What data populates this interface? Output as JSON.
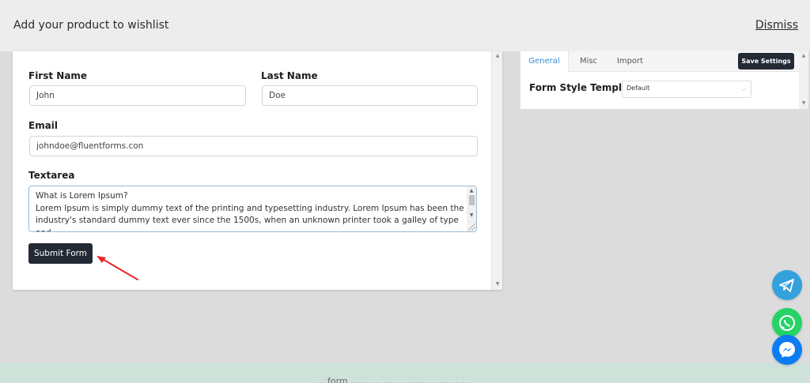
{
  "header": {
    "title": "Add your product to wishlist",
    "dismiss_label": "Dismiss"
  },
  "form": {
    "first_name": {
      "label": "First Name",
      "value": "John"
    },
    "last_name": {
      "label": "Last Name",
      "value": "Doe"
    },
    "email": {
      "label": "Email",
      "value": "johndoe@fluentforms.con"
    },
    "textarea": {
      "label": "Textarea",
      "value": "What is Lorem Ipsum?\nLorem Ipsum is simply dummy text of the printing and typesetting industry. Lorem Ipsum has been the industry's standard dummy text ever since the 1500s, when an unknown printer took a galley of type and"
    },
    "submit_label": "Submit Form"
  },
  "settings": {
    "tabs": [
      {
        "label": "General",
        "active": true
      },
      {
        "label": "Misc",
        "active": false
      },
      {
        "label": "Import",
        "active": false
      }
    ],
    "save_label": "Save Settings",
    "form_style_template": {
      "label": "Form Style Template",
      "value": "Default"
    }
  },
  "floating_buttons": [
    {
      "icon": "telegram-icon",
      "color": "#34a0dc"
    },
    {
      "icon": "whatsapp-icon",
      "color": "#25d366"
    },
    {
      "icon": "messenger-icon",
      "color": "#0c7cf3"
    }
  ],
  "footer": {
    "text": "... form ... ... ... ... ... ... ... ... ... ... ..."
  },
  "colors": {
    "primary_button": "#232a35",
    "active_tab": "#3b8ed8",
    "annotation_arrow": "#e8262a"
  }
}
